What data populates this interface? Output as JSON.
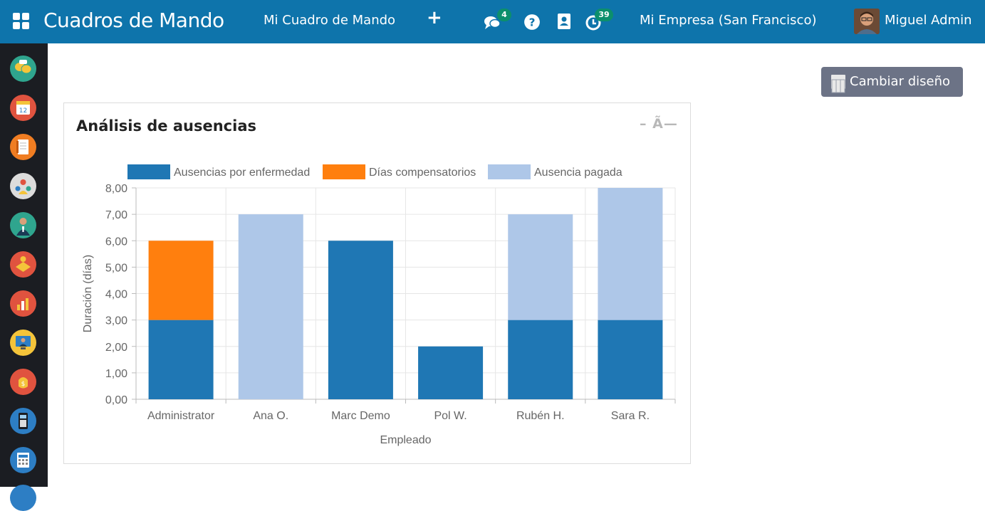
{
  "navbar": {
    "app_title": "Cuadros de Mando",
    "my_dashboard": "Mi Cuadro de Mando",
    "add_label": "+",
    "messages_count": "4",
    "activities_count": "39",
    "company": "Mi Empresa (San Francisco)",
    "user_name": "Miguel Admin",
    "icons": [
      "apps-icon",
      "chat-icon",
      "help-icon",
      "contacts-icon",
      "clock-icon"
    ],
    "color": "#0e74ab"
  },
  "sidebar": {
    "apps": [
      {
        "icon": "discuss-icon",
        "color": "#2fa58e"
      },
      {
        "icon": "calendar-icon",
        "color": "#e0533f"
      },
      {
        "icon": "notes-icon",
        "color": "#f07d22"
      },
      {
        "icon": "contacts-icon",
        "color": "#dcdcdc"
      },
      {
        "icon": "employees-icon",
        "color": "#2fa58e"
      },
      {
        "icon": "crm-icon",
        "color": "#e0533f"
      },
      {
        "icon": "sales-icon",
        "color": "#e0533f"
      },
      {
        "icon": "dashboard-icon",
        "color": "#f4c43a"
      },
      {
        "icon": "expenses-icon",
        "color": "#e0533f"
      },
      {
        "icon": "pos-icon",
        "color": "#2d7ec4"
      },
      {
        "icon": "invoicing-icon",
        "color": "#2d7ec4"
      }
    ]
  },
  "toolbar": {
    "change_layout": "Cambiar diseño"
  },
  "panel": {
    "title": "Análisis de ausencias",
    "controls": "– Ã—"
  },
  "chart_data": {
    "type": "bar",
    "stacked": true,
    "title": "",
    "xlabel": "Empleado",
    "ylabel": "Duración (días)",
    "ylim": [
      0,
      8
    ],
    "yticks": [
      "0,00",
      "1,00",
      "2,00",
      "3,00",
      "4,00",
      "5,00",
      "6,00",
      "7,00",
      "8,00"
    ],
    "grid": true,
    "legend_position": "top",
    "categories": [
      "Administrator",
      "Ana O.",
      "Marc Demo",
      "Pol W.",
      "Rubén H.",
      "Sara R."
    ],
    "series": [
      {
        "name": "Ausencias por enfermedad",
        "color": "#1f77b4",
        "values": [
          3,
          0,
          6,
          2,
          3,
          3
        ]
      },
      {
        "name": "Días compensatorios",
        "color": "#ff7f0e",
        "values": [
          3,
          0,
          0,
          0,
          0,
          0
        ]
      },
      {
        "name": "Ausencia pagada",
        "color": "#aec7e8",
        "values": [
          0,
          7,
          0,
          0,
          4,
          5
        ]
      }
    ]
  }
}
